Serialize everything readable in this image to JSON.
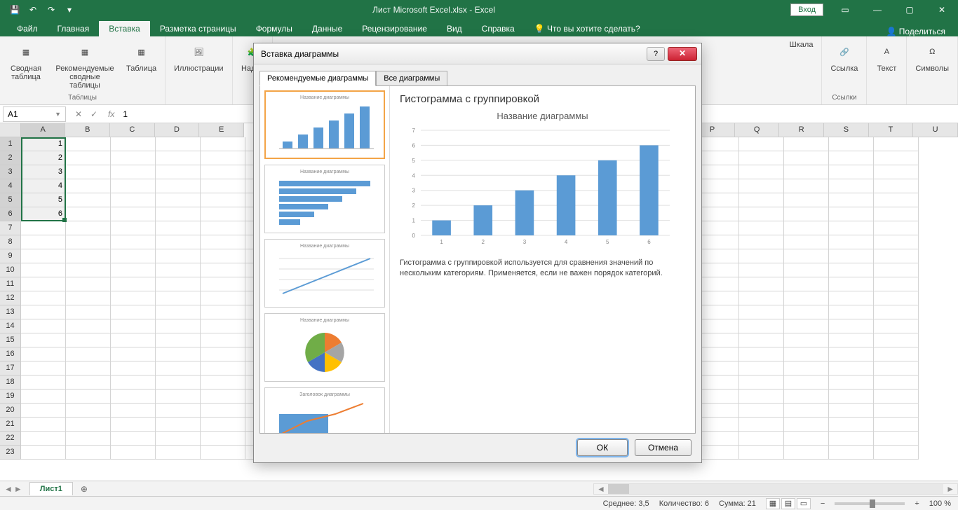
{
  "app": {
    "title": "Лист Microsoft Excel.xlsx  -  Excel",
    "login": "Вход"
  },
  "tabs": {
    "file": "Файл",
    "home": "Главная",
    "insert": "Вставка",
    "layout": "Разметка страницы",
    "formulas": "Формулы",
    "data": "Данные",
    "review": "Рецензирование",
    "view": "Вид",
    "help": "Справка",
    "tellme": "Что вы хотите сделать?",
    "share": "Поделиться"
  },
  "ribbon": {
    "pivot": "Сводная таблица",
    "recpivot": "Рекомендуемые сводные таблицы",
    "table": "Таблица",
    "tables_group": "Таблицы",
    "illustrations": "Иллюстрации",
    "addins": "Надст",
    "scale": "Шкала",
    "link": "Ссылка",
    "links_group": "Ссылки",
    "text": "Текст",
    "symbols": "Символы"
  },
  "namebox": "A1",
  "formula_value": "1",
  "columns": [
    "A",
    "B",
    "C",
    "D",
    "E",
    "P",
    "Q",
    "R",
    "S",
    "T",
    "U"
  ],
  "cells": {
    "A1": "1",
    "A2": "2",
    "A3": "3",
    "A4": "4",
    "A5": "5",
    "A6": "6"
  },
  "sheet": "Лист1",
  "status": {
    "avg": "Среднее: 3,5",
    "count": "Количество: 6",
    "sum": "Сумма: 21",
    "zoom": "100 %"
  },
  "dialog": {
    "title": "Вставка диаграммы",
    "tab_rec": "Рекомендуемые диаграммы",
    "tab_all": "Все диаграммы",
    "thumb_title": "Название диаграммы",
    "thumb_title2": "Заголовок диаграммы",
    "detail_title": "Гистограмма с группировкой",
    "preview_title": "Название диаграммы",
    "desc": "Гистограмма с группировкой используется для сравнения значений по нескольким категориям. Применяется, если не важен порядок категорий.",
    "ok": "ОК",
    "cancel": "Отмена"
  },
  "chart_data": {
    "type": "bar",
    "title": "Название диаграммы",
    "categories": [
      1,
      2,
      3,
      4,
      5,
      6
    ],
    "values": [
      1,
      2,
      3,
      4,
      5,
      6
    ],
    "y_ticks": [
      0,
      1,
      2,
      3,
      4,
      5,
      6,
      7
    ],
    "ylim": [
      0,
      7
    ]
  }
}
